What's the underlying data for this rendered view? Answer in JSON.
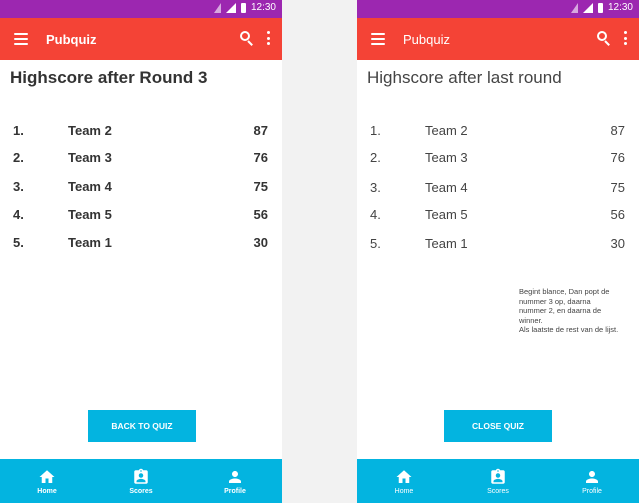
{
  "status_bar": {
    "time": "12:30"
  },
  "screens": [
    {
      "app_title": "Pubquiz",
      "heading": "Highscore after Round 3",
      "ranking": [
        {
          "pos": "1.",
          "team": "Team 2",
          "score": "87"
        },
        {
          "pos": "2.",
          "team": "Team 3",
          "score": "76"
        },
        {
          "pos": "3.",
          "team": "Team 4",
          "score": "75"
        },
        {
          "pos": "4.",
          "team": "Team 5",
          "score": "56"
        },
        {
          "pos": "5.",
          "team": "Team 1",
          "score": "30"
        }
      ],
      "button_label": "BACK TO QUIZ",
      "nav": [
        "Home",
        "Scores",
        "Profile"
      ]
    },
    {
      "app_title": "Pubquiz",
      "heading": "Highscore after last round",
      "ranking": [
        {
          "pos": "1.",
          "team": "Team 2",
          "score": "87"
        },
        {
          "pos": "2.",
          "team": "Team 3",
          "score": "76"
        },
        {
          "pos": "3.",
          "team": "Team 4",
          "score": "75"
        },
        {
          "pos": "4.",
          "team": "Team 5",
          "score": "56"
        },
        {
          "pos": "5.",
          "team": "Team 1",
          "score": "30"
        }
      ],
      "note": "Begint blance, Dan popt de nummer 3 op, daarna nummer 2, en daarna de winner.\nAls laatste de rest van de lijst.",
      "button_label": "CLOSE QUIZ",
      "nav": [
        "Home",
        "Scores",
        "Profile"
      ]
    }
  ],
  "colors": {
    "status_bar": "#9c27b0",
    "app_bar": "#f44336",
    "accent": "#03b4e0"
  },
  "icons": [
    "menu-icon",
    "search-icon",
    "more-vert-icon",
    "home-icon",
    "scores-icon",
    "profile-icon",
    "signal-icon",
    "battery-icon"
  ]
}
